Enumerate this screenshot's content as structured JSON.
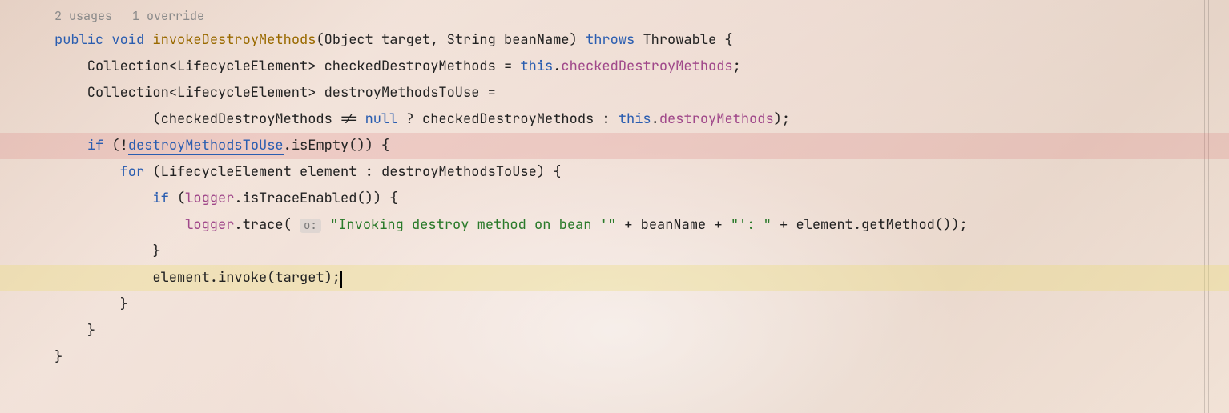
{
  "hints": {
    "usages": "2 usages",
    "override": "1 override"
  },
  "k": {
    "public": "public",
    "void": "void",
    "throws": "throws",
    "this": "this",
    "null": "null",
    "if": "if",
    "for": "for"
  },
  "decl": {
    "method": "invokeDestroyMethods",
    "sigOpen": "(Object target, String beanName) ",
    "throwable": "Throwable {"
  },
  "l1": {
    "a": "    Collection<LifecycleElement> checkedDestroyMethods = ",
    "dot": ".",
    "field": "checkedDestroyMethods",
    "semi": ";"
  },
  "l2": {
    "a": "    Collection<LifecycleElement> destroyMethodsToUse ="
  },
  "l3": {
    "a": "            (checkedDestroyMethods != ",
    "b": " ? checkedDestroyMethods : ",
    "dot": ".",
    "field": "destroyMethods",
    "c": ");"
  },
  "l4": {
    "a": "    ",
    "b": " (!",
    "link": "destroyMethodsToUse",
    "c": ".isEmpty()) {"
  },
  "l5": {
    "a": "        ",
    "b": " (LifecycleElement element : destroyMethodsToUse) {"
  },
  "l6": {
    "a": "            ",
    "b": " (",
    "logger": "logger",
    "c": ".isTraceEnabled()) {"
  },
  "l7": {
    "a": "                ",
    "logger": "logger",
    "b": ".trace( ",
    "hint": "o:",
    "str1": "\"Invoking destroy method on bean '\"",
    "c": " + beanName + ",
    "str2": "\"': \"",
    "d": " + element.getMethod());"
  },
  "l8": {
    "a": "            }"
  },
  "l9": {
    "a": "            element.invoke(target);"
  },
  "l10": {
    "a": "        }"
  },
  "l11": {
    "a": "    }"
  },
  "l12": {
    "a": "}"
  }
}
